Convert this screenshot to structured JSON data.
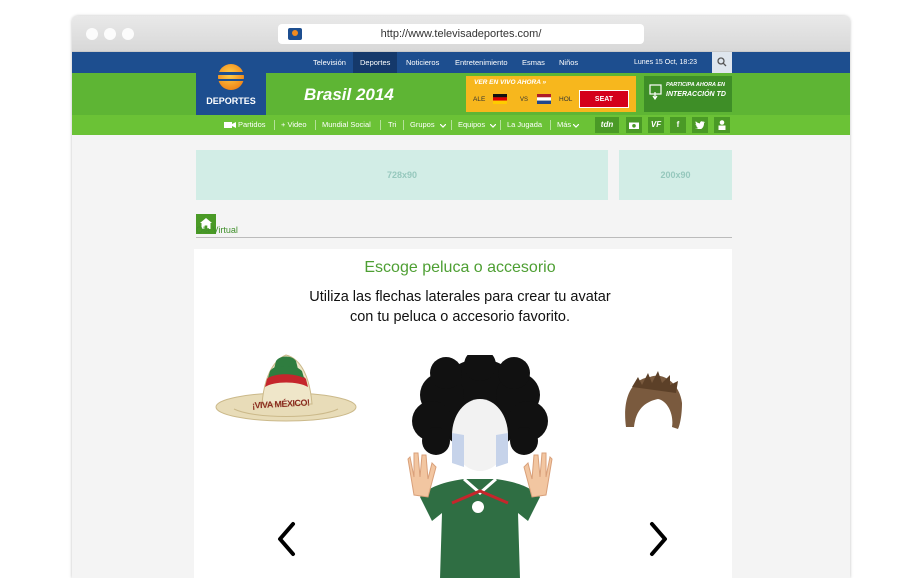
{
  "browser": {
    "url": "http://www.televisadeportes.com/"
  },
  "topnav": {
    "items": [
      "Televisión",
      "Deportes",
      "Noticieros",
      "Entretenimiento",
      "Esmas",
      "Niños"
    ],
    "active": "Deportes",
    "date": "Lunes 15 Oct, 18:23"
  },
  "header": {
    "logo_text": "DEPORTES",
    "event_title": "Brasil 2014",
    "live": {
      "label": "VER EN VIVO AHORA »",
      "team1": "ALE",
      "vs": "VS",
      "team2": "HOL",
      "sponsor": "SEAT"
    },
    "td": {
      "line1": "PARTICIPA AHORA EN",
      "line2": "INTERACCIÓN TD"
    }
  },
  "subnav": {
    "items": [
      "Partidos",
      "+ Video",
      "Mundial Social",
      "Tri",
      "Grupos",
      "Equipos",
      "La Jugada",
      "Más"
    ],
    "icons": [
      "tdn-icon",
      "camera-icon",
      "vf-icon",
      "facebook-icon",
      "twitter-icon",
      "user-icon"
    ]
  },
  "ads": {
    "banner": "728x90",
    "side": "200x90"
  },
  "section": {
    "title": "Ola Virtual"
  },
  "panel": {
    "title": "Escoge peluca o accesorio",
    "subtitle_line1": "Utiliza las flechas laterales para crear tu avatar",
    "subtitle_line2": "con tu peluca o accesorio favorito.",
    "hat_text": "¡VIVA MÉXICO!"
  },
  "colors": {
    "blue": "#1d4e8f",
    "green": "#5eb534",
    "gold": "#f7b71d",
    "seat_red": "#d4001b"
  }
}
